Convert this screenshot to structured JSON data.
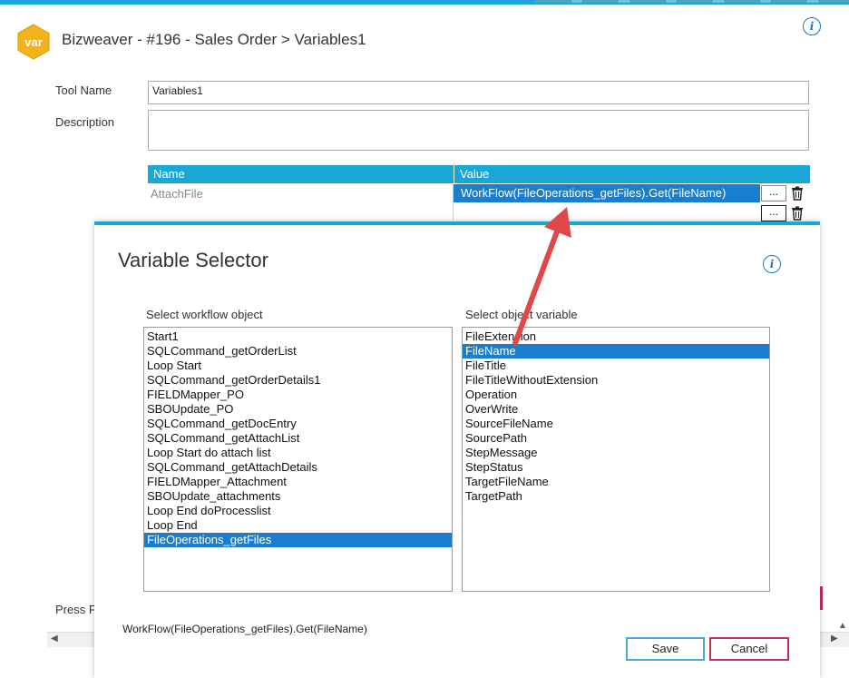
{
  "window": {
    "title": "Bizweaver - #196 - Sales Order > Variables1",
    "logo_text": "var"
  },
  "form": {
    "tool_name_label": "Tool Name",
    "tool_name_value": "Variables1",
    "description_label": "Description",
    "description_value": "",
    "press_label_partial": "Press F"
  },
  "grid": {
    "col_name": "Name",
    "col_value": "Value",
    "rows": [
      {
        "name": "AttachFile",
        "value": "WorkFlow(FileOperations_getFiles).Get(FileName)",
        "button": "..."
      },
      {
        "name": "",
        "value": "",
        "button": "..."
      }
    ]
  },
  "dialog": {
    "title": "Variable Selector",
    "workflow_label": "Select workflow object",
    "variable_label": "Select object variable",
    "workflow_items": [
      "Start1",
      "SQLCommand_getOrderList",
      "Loop Start",
      "SQLCommand_getOrderDetails1",
      "FIELDMapper_PO",
      "SBOUpdate_PO",
      "SQLCommand_getDocEntry",
      "SQLCommand_getAttachList",
      "Loop Start do attach list",
      "SQLCommand_getAttachDetails",
      "FIELDMapper_Attachment",
      "SBOUpdate_attachments",
      "Loop End doProcesslist",
      "Loop End",
      "FileOperations_getFiles"
    ],
    "workflow_selected": 14,
    "variable_items": [
      "FileExtension",
      "FileName",
      "FileTitle",
      "FileTitleWithoutExtension",
      "Operation",
      "OverWrite",
      "SourceFileName",
      "SourcePath",
      "StepMessage",
      "StepStatus",
      "TargetFileName",
      "TargetPath"
    ],
    "variable_selected": 1,
    "expression": "WorkFlow(FileOperations_getFiles).Get(FileName)",
    "save_label": "Save",
    "cancel_label": "Cancel"
  },
  "colors": {
    "accent": "#1aa7d6",
    "selection": "#1a7ed0",
    "arrow": "#e04848",
    "cancel_border": "#c42e5b",
    "logo": "#f2b418"
  },
  "icons": [
    "info-icon",
    "trash-icon",
    "var-logo-icon",
    "scroll-left-icon",
    "scroll-right-icon",
    "annotation-arrow"
  ]
}
